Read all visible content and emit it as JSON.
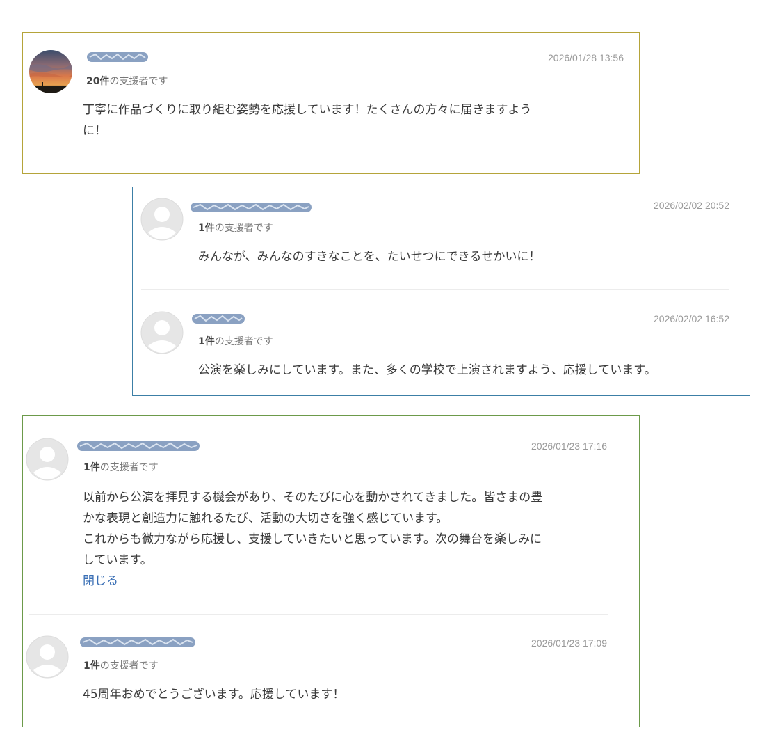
{
  "thread1": {
    "comments": [
      {
        "supporter_count": "20件",
        "supporter_suffix": "の支援者です",
        "date": "2026/01/28 13:56",
        "body": [
          "丁寧に作品づくりに取り組む姿勢を応援しています！たくさんの方々に届きますよう",
          "に！"
        ]
      }
    ]
  },
  "thread2": {
    "comments": [
      {
        "supporter_count": "1件",
        "supporter_suffix": "の支援者です",
        "date": "2026/02/02 20:52",
        "body": [
          "みんなが、みんなのすきなことを、たいせつにできるせかいに！"
        ]
      },
      {
        "supporter_count": "1件",
        "supporter_suffix": "の支援者です",
        "date": "2026/02/02 16:52",
        "body": [
          "公演を楽しみにしています。また、多くの学校で上演されますよう、応援しています。"
        ]
      }
    ]
  },
  "thread3": {
    "comments": [
      {
        "supporter_count": "1件",
        "supporter_suffix": "の支援者です",
        "date": "2026/01/23 17:16",
        "body": [
          "以前から公演を拝見する機会があり、そのたびに心を動かされてきました。皆さまの豊",
          "かな表現と創造力に触れるたび、活動の大切さを強く感じています。",
          "これからも微力ながら応援し、支援していきたいと思っています。次の舞台を楽しみに",
          "しています。"
        ],
        "collapse_label": "閉じる"
      },
      {
        "supporter_count": "1件",
        "supporter_suffix": "の支援者です",
        "date": "2026/01/23 17:09",
        "body": [
          "45周年おめでとうございます。応援しています！"
        ]
      }
    ]
  },
  "colors": {
    "card1_border": "#b5a43a",
    "card2_border": "#3c7fa6",
    "card3_border": "#6c9a4a",
    "link": "#3a6fb5"
  },
  "icons": {
    "default_avatar": "default-user-avatar-icon",
    "photo_avatar": "sunset-photo-avatar"
  }
}
